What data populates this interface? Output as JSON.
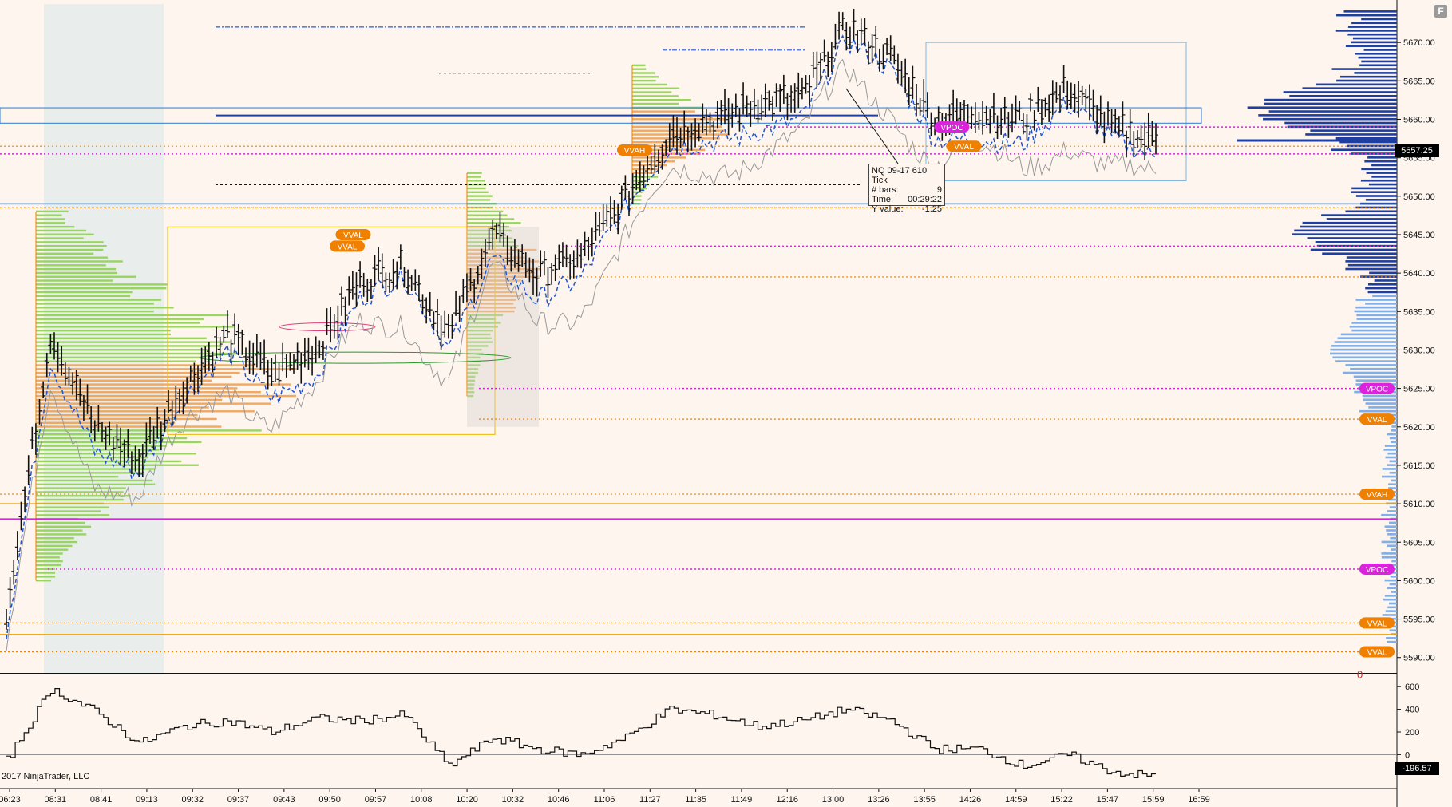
{
  "app": {
    "copyright": "2017 NinjaTrader, LLC",
    "corner_button": "F"
  },
  "colors": {
    "background": "#fdf5ee",
    "bar": "#111111",
    "vwap": "#2255cc",
    "vpoc": "#dd22dd",
    "value_area": "#f08000",
    "profile_green": "#8fd14f",
    "profile_orange": "#f0a050",
    "volume_profile": "#1f3fa0"
  },
  "price_axis": {
    "labels": [
      "5670.00",
      "5665.00",
      "5660.00",
      "5655.00",
      "5650.00",
      "5645.00",
      "5640.00",
      "5635.00",
      "5630.00",
      "5625.00",
      "5620.00",
      "5615.00",
      "5610.00",
      "5605.00",
      "5600.00",
      "5595.00",
      "5590.00"
    ],
    "last_price": "5657.25"
  },
  "price_markers": [
    {
      "text": "VPOC",
      "price": 5625.0,
      "color": "#dd22dd"
    },
    {
      "text": "VVAL",
      "price": 5621.0,
      "color": "#f08000"
    },
    {
      "text": "VVAH",
      "price": 5611.25,
      "color": "#f08000"
    },
    {
      "text": "VPOC",
      "price": 5601.5,
      "color": "#dd22dd"
    },
    {
      "text": "VVAL",
      "price": 5594.5,
      "color": "#f08000"
    },
    {
      "text": "VVAL",
      "price": 5590.75,
      "color": "#f08000"
    }
  ],
  "chart_labels": [
    {
      "text": "VPOC",
      "price": 5659.0,
      "time_frac": 0.795,
      "color": "#dd22dd"
    },
    {
      "text": "VVAL",
      "price": 5656.5,
      "time_frac": 0.805,
      "color": "#f08000"
    },
    {
      "text": "VVAH",
      "price": 5656.0,
      "time_frac": 0.53,
      "color": "#f08000"
    },
    {
      "text": "VVAL",
      "price": 5645.0,
      "time_frac": 0.295,
      "color": "#f08000"
    },
    {
      "text": "VVAL",
      "price": 5643.5,
      "time_frac": 0.29,
      "color": "#f08000"
    }
  ],
  "tooltip": {
    "title": "NQ 09-17 610 Tick",
    "rows": [
      {
        "label": "# bars:",
        "value": "9"
      },
      {
        "label": "Time:",
        "value": "00:29:22"
      },
      {
        "label": "Y value:",
        "value": "-1.25"
      }
    ]
  },
  "indicator": {
    "labels": [
      "600",
      "400",
      "200",
      "0"
    ],
    "last_value": "-196.57",
    "zero_marker": "0"
  },
  "time_axis": {
    "labels": [
      "06:23",
      "08:31",
      "08:41",
      "09:13",
      "09:32",
      "09:37",
      "09:43",
      "09:50",
      "09:57",
      "10:08",
      "10:20",
      "10:32",
      "10:46",
      "11:06",
      "11:27",
      "11:35",
      "11:49",
      "12:16",
      "13:00",
      "13:26",
      "13:55",
      "14:26",
      "14:59",
      "15:22",
      "15:47",
      "15:59",
      "16:59"
    ]
  },
  "chart_data": {
    "type": "line",
    "instrument": "NQ 09-17 610 Tick",
    "ylim": [
      5588,
      5675
    ],
    "indicator_ylim": [
      -300,
      700
    ],
    "x": [
      "06:23",
      "08:31",
      "08:41",
      "09:13",
      "09:32",
      "09:37",
      "09:43",
      "09:50",
      "09:57",
      "10:08",
      "10:20",
      "10:32",
      "10:46",
      "11:06",
      "11:27",
      "11:35",
      "11:49",
      "12:16",
      "13:00",
      "13:26",
      "13:55",
      "14:26",
      "14:59",
      "15:22",
      "15:47",
      "15:59",
      "16:59"
    ],
    "series": [
      {
        "values": [
          5596,
          5632,
          5620,
          5616,
          5625,
          5632,
          5627,
          5630,
          5639,
          5641,
          5632,
          5645,
          5640,
          5642,
          5650,
          5658,
          5660,
          5662,
          5663,
          5672,
          5668,
          5660,
          5661,
          5660,
          5664,
          5659,
          5657.25
        ]
      },
      {
        "values": [
          -50,
          580,
          380,
          100,
          250,
          300,
          200,
          320,
          300,
          350,
          -100,
          150,
          50,
          0,
          150,
          400,
          350,
          250,
          300,
          400,
          300,
          50,
          50,
          -100,
          0,
          -150,
          -196.57
        ]
      }
    ]
  }
}
